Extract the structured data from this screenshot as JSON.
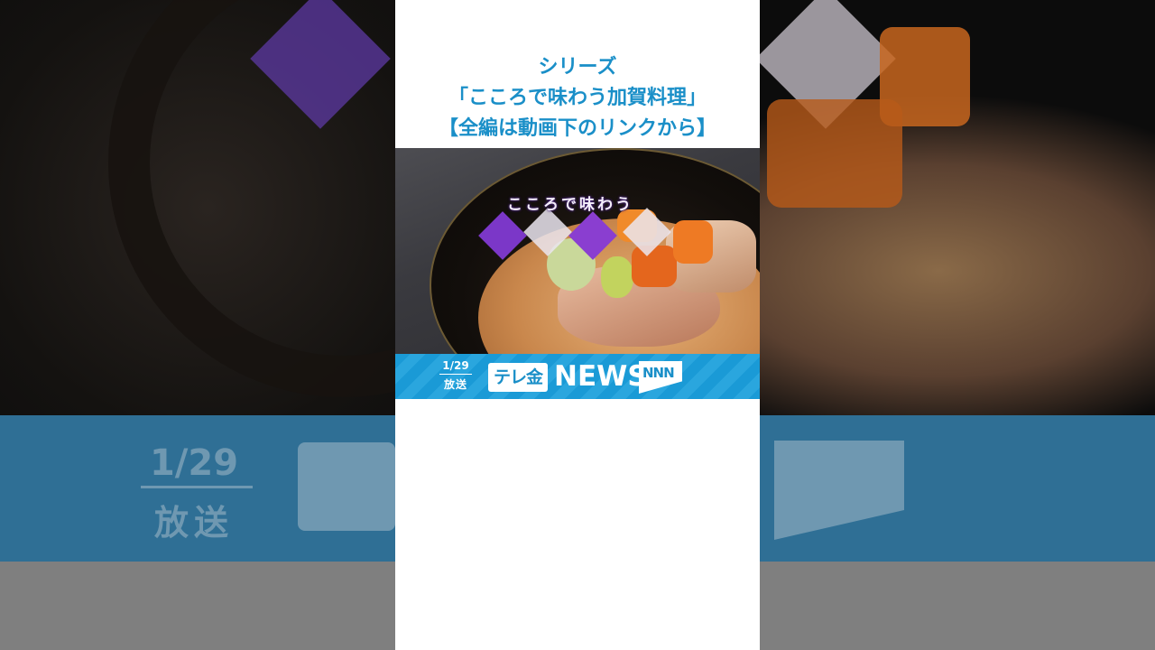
{
  "title": {
    "line1": "シリーズ",
    "line2": "「こころで味わう加賀料理」",
    "line3": "【全編は動画下のリンクから】"
  },
  "video": {
    "caption": "こころで味わう"
  },
  "news_band": {
    "date": "1/29",
    "broadcast": "放送",
    "station_logo": "テレ金",
    "news_label": "NEWS",
    "network_logo": "NNN"
  },
  "colors": {
    "title_blue": "#1a8fc8",
    "band_blue": "#1a9ad6",
    "frame_bg": "#ffffff"
  }
}
